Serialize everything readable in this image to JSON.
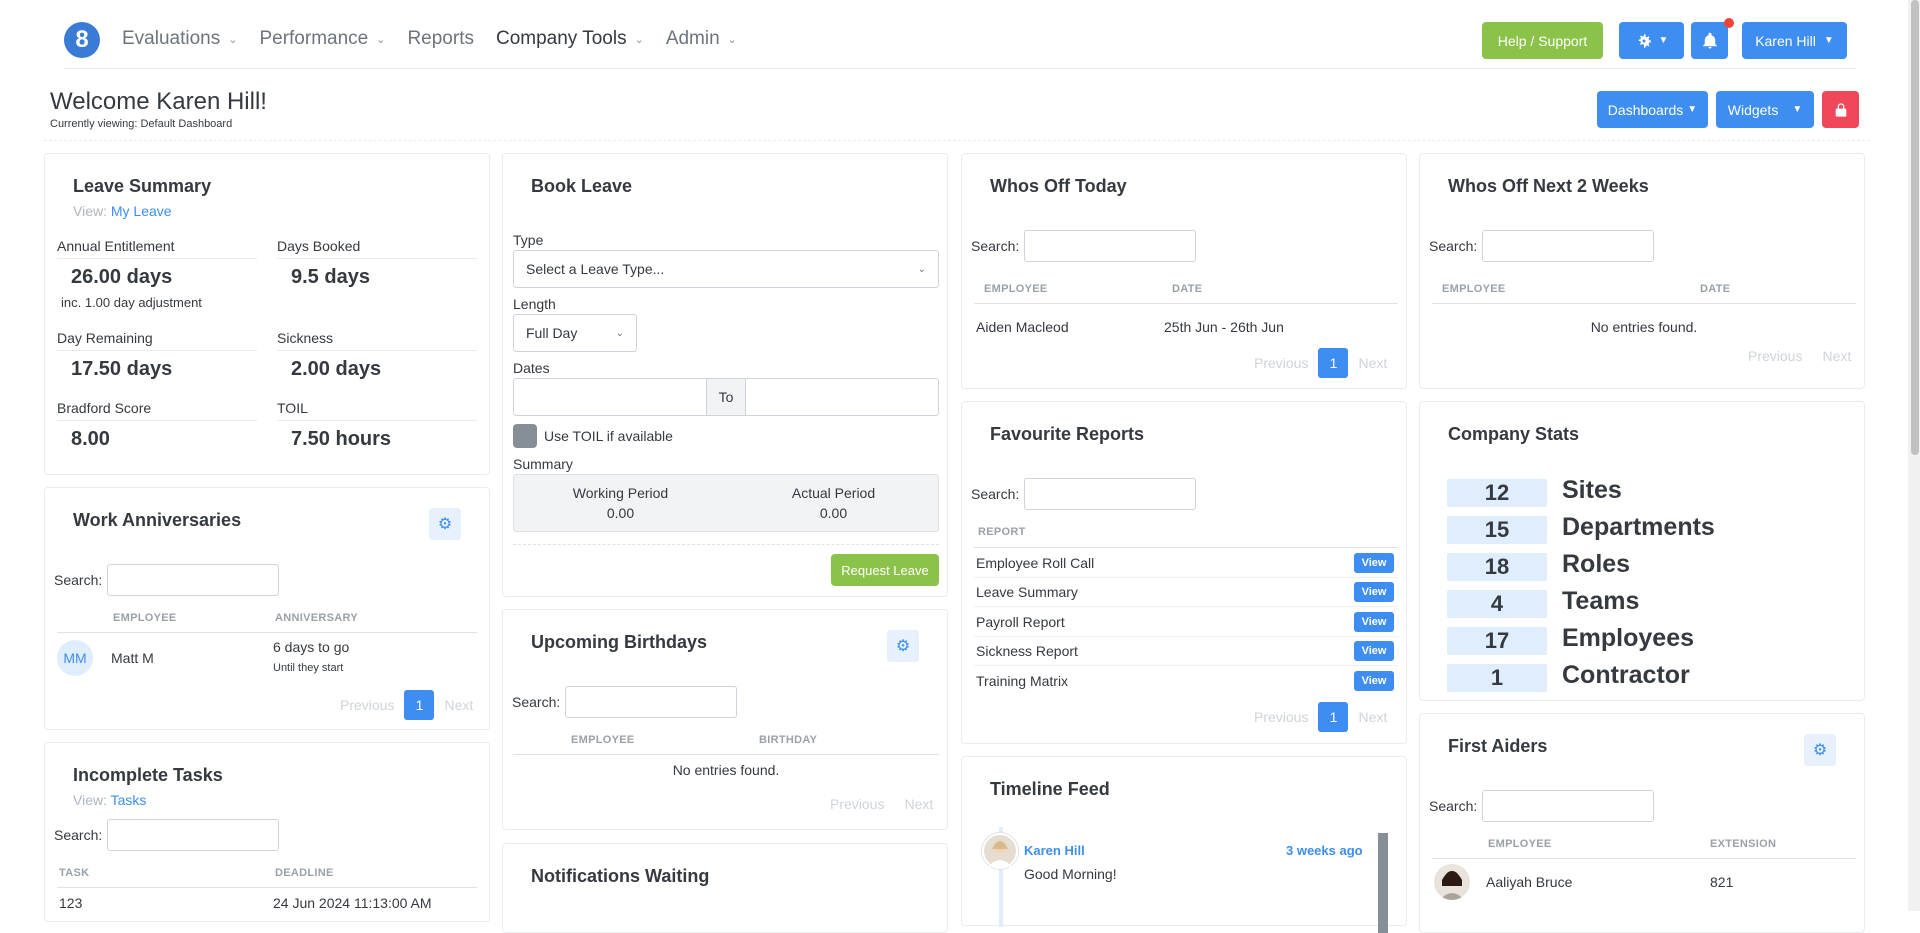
{
  "logo": "8",
  "nav": [
    {
      "label": "Evaluations",
      "chevron": true
    },
    {
      "label": "Performance",
      "chevron": true
    },
    {
      "label": "Reports",
      "chevron": false
    },
    {
      "label": "Company Tools",
      "chevron": true
    },
    {
      "label": "Admin",
      "chevron": true
    }
  ],
  "header": {
    "help_label": "Help / Support",
    "user_label": "Karen Hill",
    "welcome": "Welcome Karen Hill!",
    "viewing": "Currently viewing: Default Dashboard",
    "dashboards_label": "Dashboards",
    "widgets_label": "Widgets"
  },
  "leave_summary": {
    "title": "Leave Summary",
    "view_prefix": "View:",
    "view_link": "My Leave",
    "annual_label": "Annual Entitlement",
    "annual_value": "26.00 days",
    "annual_note": "inc. 1.00 day adjustment",
    "booked_label": "Days Booked",
    "booked_value": "9.5 days",
    "remaining_label": "Day Remaining",
    "remaining_value": "17.50 days",
    "sickness_label": "Sickness",
    "sickness_value": "2.00 days",
    "bradford_label": "Bradford Score",
    "bradford_value": "8.00",
    "toil_label": "TOIL",
    "toil_value": "7.50 hours"
  },
  "book_leave": {
    "title": "Book Leave",
    "type_label": "Type",
    "type_placeholder": "Select a Leave Type...",
    "length_label": "Length",
    "length_value": "Full Day",
    "dates_label": "Dates",
    "to_label": "To",
    "toil_label": "Use TOIL if available",
    "summary_label": "Summary",
    "working_label": "Working Period",
    "working_value": "0.00",
    "actual_label": "Actual Period",
    "actual_value": "0.00",
    "request_label": "Request Leave"
  },
  "whos_off_today": {
    "title": "Whos Off Today",
    "search_label": "Search:",
    "col_employee": "EMPLOYEE",
    "col_date": "DATE",
    "rows": [
      {
        "employee": "Aiden Macleod",
        "date": "25th Jun - 26th Jun"
      }
    ],
    "prev": "Previous",
    "page": "1",
    "next": "Next"
  },
  "whos_off_next": {
    "title": "Whos Off Next 2 Weeks",
    "search_label": "Search:",
    "col_employee": "EMPLOYEE",
    "col_date": "DATE",
    "empty": "No entries found.",
    "prev": "Previous",
    "next": "Next"
  },
  "work_anniversaries": {
    "title": "Work Anniversaries",
    "search_label": "Search:",
    "col_employee": "EMPLOYEE",
    "col_anniversary": "ANNIVERSARY",
    "initials": "MM",
    "employee": "Matt M",
    "anniversary": "6 days to go",
    "anniversary_note": "Until they start",
    "prev": "Previous",
    "page": "1",
    "next": "Next"
  },
  "incomplete_tasks": {
    "title": "Incomplete Tasks",
    "view_prefix": "View:",
    "view_link": "Tasks",
    "search_label": "Search:",
    "col_task": "TASK",
    "col_deadline": "DEADLINE",
    "task": "123",
    "deadline": "24 Jun 2024 11:13:00 AM"
  },
  "favourite_reports": {
    "title": "Favourite Reports",
    "search_label": "Search:",
    "col_report": "REPORT",
    "view_label": "View",
    "reports": [
      "Employee Roll Call",
      "Leave Summary",
      "Payroll Report",
      "Sickness Report",
      "Training Matrix"
    ],
    "prev": "Previous",
    "page": "1",
    "next": "Next"
  },
  "upcoming_birthdays": {
    "title": "Upcoming Birthdays",
    "search_label": "Search:",
    "col_employee": "EMPLOYEE",
    "col_birthday": "BIRTHDAY",
    "empty": "No entries found.",
    "prev": "Previous",
    "next": "Next"
  },
  "company_stats": {
    "title": "Company Stats",
    "stats": [
      {
        "value": "12",
        "label": "Sites"
      },
      {
        "value": "15",
        "label": "Departments"
      },
      {
        "value": "18",
        "label": "Roles"
      },
      {
        "value": "4",
        "label": "Teams"
      },
      {
        "value": "17",
        "label": "Employees"
      },
      {
        "value": "1",
        "label": "Contractor"
      }
    ]
  },
  "timeline": {
    "title": "Timeline Feed",
    "author": "Karen Hill",
    "time": "3 weeks ago",
    "message": "Good Morning!"
  },
  "notifications": {
    "title": "Notifications Waiting"
  },
  "first_aiders": {
    "title": "First Aiders",
    "search_label": "Search:",
    "col_employee": "EMPLOYEE",
    "col_extension": "EXTENSION",
    "employee": "Aaliyah Bruce",
    "extension": "821"
  },
  "colors": {
    "primary": "#3d8ef0",
    "success": "#8bc34a",
    "danger": "#f0475a"
  }
}
